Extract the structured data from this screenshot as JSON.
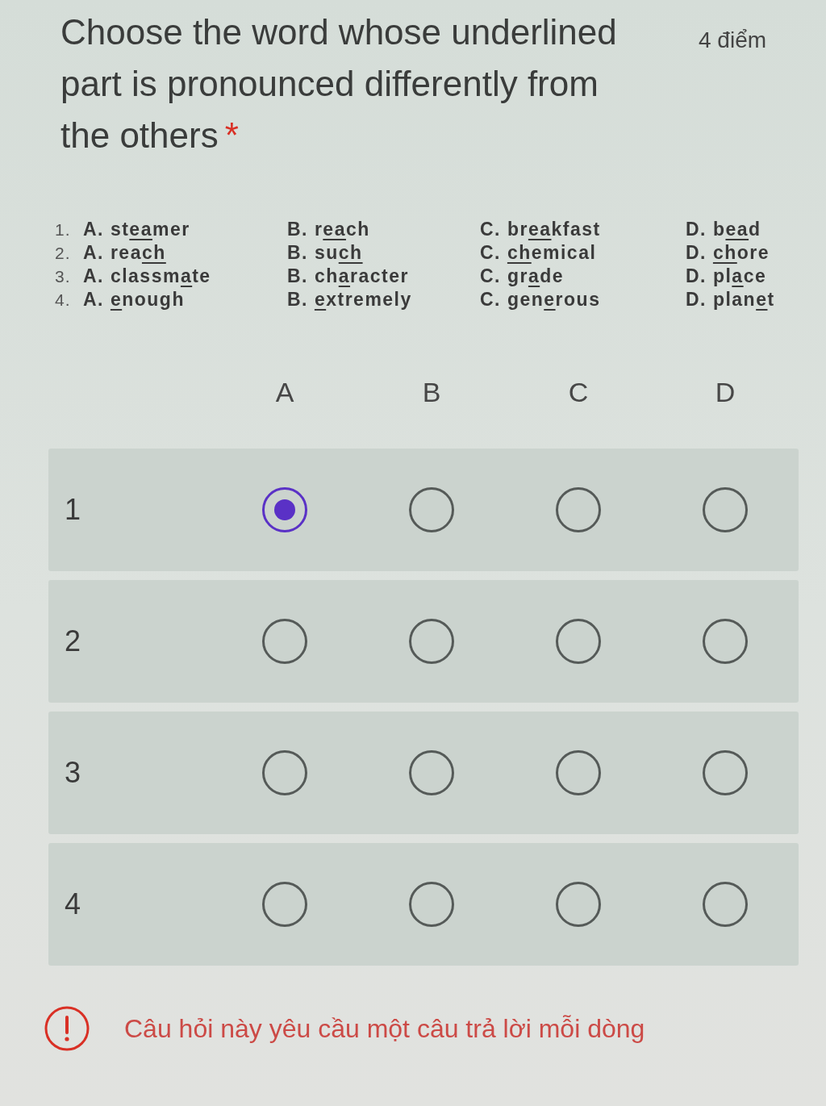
{
  "question": {
    "title": "Choose the word whose underlined part is pronounced differently from the others",
    "required_mark": "*",
    "points": "4 điểm"
  },
  "exercise": [
    {
      "number": "1.",
      "options": [
        {
          "letter": "A.",
          "parts": [
            {
              "text": "st",
              "underlined": false
            },
            {
              "text": "ea",
              "underlined": true
            },
            {
              "text": "mer",
              "underlined": false
            }
          ]
        },
        {
          "letter": "B.",
          "parts": [
            {
              "text": "r",
              "underlined": false
            },
            {
              "text": "ea",
              "underlined": true
            },
            {
              "text": "ch",
              "underlined": false
            }
          ]
        },
        {
          "letter": "C.",
          "parts": [
            {
              "text": "br",
              "underlined": false
            },
            {
              "text": "ea",
              "underlined": true
            },
            {
              "text": "kfast",
              "underlined": false
            }
          ]
        },
        {
          "letter": "D.",
          "parts": [
            {
              "text": "b",
              "underlined": false
            },
            {
              "text": "ea",
              "underlined": true
            },
            {
              "text": "d",
              "underlined": false
            }
          ]
        }
      ]
    },
    {
      "number": "2.",
      "options": [
        {
          "letter": "A.",
          "parts": [
            {
              "text": "rea",
              "underlined": false
            },
            {
              "text": "ch",
              "underlined": true
            }
          ]
        },
        {
          "letter": "B.",
          "parts": [
            {
              "text": "su",
              "underlined": false
            },
            {
              "text": "ch",
              "underlined": true
            }
          ]
        },
        {
          "letter": "C.",
          "parts": [
            {
              "text": "ch",
              "underlined": true
            },
            {
              "text": "emical",
              "underlined": false
            }
          ]
        },
        {
          "letter": "D.",
          "parts": [
            {
              "text": "ch",
              "underlined": true
            },
            {
              "text": "ore",
              "underlined": false
            }
          ]
        }
      ]
    },
    {
      "number": "3.",
      "options": [
        {
          "letter": "A.",
          "parts": [
            {
              "text": "classm",
              "underlined": false
            },
            {
              "text": "a",
              "underlined": true
            },
            {
              "text": "te",
              "underlined": false
            }
          ]
        },
        {
          "letter": "B.",
          "parts": [
            {
              "text": "ch",
              "underlined": false
            },
            {
              "text": "a",
              "underlined": true
            },
            {
              "text": "racter",
              "underlined": false
            }
          ]
        },
        {
          "letter": "C.",
          "parts": [
            {
              "text": "gr",
              "underlined": false
            },
            {
              "text": "a",
              "underlined": true
            },
            {
              "text": "de",
              "underlined": false
            }
          ]
        },
        {
          "letter": "D.",
          "parts": [
            {
              "text": "pl",
              "underlined": false
            },
            {
              "text": "a",
              "underlined": true
            },
            {
              "text": "ce",
              "underlined": false
            }
          ]
        }
      ]
    },
    {
      "number": "4.",
      "options": [
        {
          "letter": "A.",
          "parts": [
            {
              "text": "e",
              "underlined": true
            },
            {
              "text": "nough",
              "underlined": false
            }
          ]
        },
        {
          "letter": "B.",
          "parts": [
            {
              "text": "e",
              "underlined": true
            },
            {
              "text": "xtremely",
              "underlined": false
            }
          ]
        },
        {
          "letter": "C.",
          "parts": [
            {
              "text": "gen",
              "underlined": false
            },
            {
              "text": "e",
              "underlined": true
            },
            {
              "text": "rous",
              "underlined": false
            }
          ]
        },
        {
          "letter": "D.",
          "parts": [
            {
              "text": "plan",
              "underlined": false
            },
            {
              "text": "e",
              "underlined": true
            },
            {
              "text": "t",
              "underlined": false
            }
          ]
        }
      ]
    }
  ],
  "grid": {
    "columns": [
      "A",
      "B",
      "C",
      "D"
    ],
    "rows": [
      {
        "label": "1",
        "choices": [
          {
            "selected": true
          },
          {
            "selected": false
          },
          {
            "selected": false
          },
          {
            "selected": false
          }
        ]
      },
      {
        "label": "2",
        "choices": [
          {
            "selected": false
          },
          {
            "selected": false
          },
          {
            "selected": false
          },
          {
            "selected": false
          }
        ]
      },
      {
        "label": "3",
        "choices": [
          {
            "selected": false
          },
          {
            "selected": false
          },
          {
            "selected": false
          },
          {
            "selected": false
          }
        ]
      },
      {
        "label": "4",
        "choices": [
          {
            "selected": false
          },
          {
            "selected": false
          },
          {
            "selected": false
          },
          {
            "selected": false
          }
        ]
      }
    ]
  },
  "error": {
    "message": "Câu hỏi này yêu cầu một câu trả lời mỗi dòng"
  }
}
